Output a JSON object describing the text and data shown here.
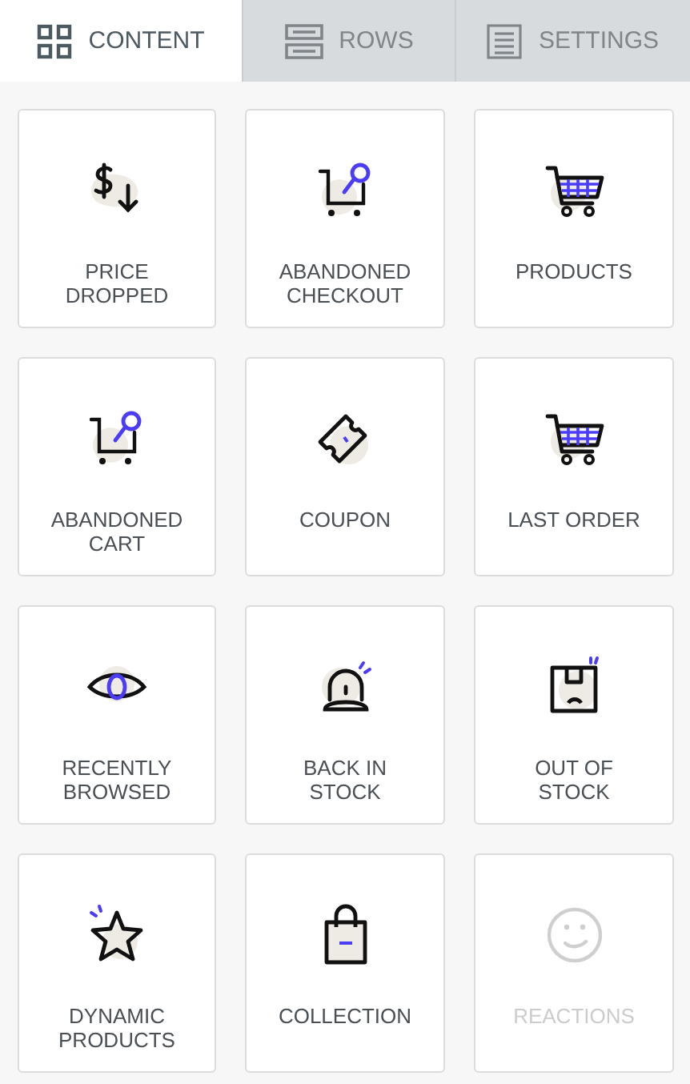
{
  "tabs": [
    {
      "label": "CONTENT",
      "kind": "grid",
      "selected": true
    },
    {
      "label": "ROWS",
      "kind": "rows",
      "selected": false
    },
    {
      "label": "SETTINGS",
      "kind": "doc",
      "selected": false
    }
  ],
  "blocks": [
    {
      "label": "PRICE DROPPED",
      "kind": "price",
      "disabled": false
    },
    {
      "label": "ABANDONED CHECKOUT",
      "kind": "cart-search",
      "disabled": false
    },
    {
      "label": "PRODUCTS",
      "kind": "cart",
      "disabled": false
    },
    {
      "label": "ABANDONED CART",
      "kind": "cart-search",
      "disabled": false
    },
    {
      "label": "COUPON",
      "kind": "ticket",
      "disabled": false
    },
    {
      "label": "LAST ORDER",
      "kind": "cart",
      "disabled": false
    },
    {
      "label": "RECENTLY BROWSED",
      "kind": "eye",
      "disabled": false
    },
    {
      "label": "BACK IN STOCK",
      "kind": "bell",
      "disabled": false
    },
    {
      "label": "OUT OF STOCK",
      "kind": "box",
      "disabled": false
    },
    {
      "label": "DYNAMIC PRODUCTS",
      "kind": "star",
      "disabled": false
    },
    {
      "label": "COLLECTION",
      "kind": "bag",
      "disabled": false
    },
    {
      "label": "REACTIONS",
      "kind": "smile",
      "disabled": true
    }
  ]
}
